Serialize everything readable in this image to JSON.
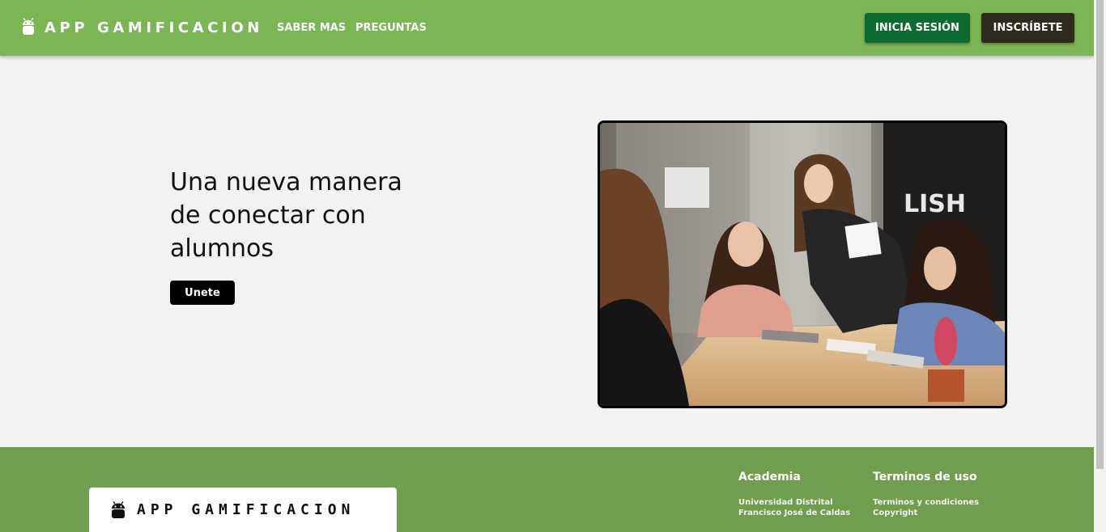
{
  "header": {
    "brand": "APP GAMIFICACION",
    "nav": [
      "SABER MAS",
      "PREGUNTAS"
    ],
    "login_label": "INICIA SESIÓN",
    "signup_label": "INSCRÍBETE"
  },
  "hero": {
    "title": "Una nueva manera de conectar con alumnos",
    "join_label": "Unete",
    "image_icon": "classroom-photo"
  },
  "footer": {
    "brand": "APP GAMIFICACION",
    "columns": [
      {
        "title": "Academia",
        "links": [
          "Universidad Distrital Francisco José de Caldas"
        ]
      },
      {
        "title": "Terminos de uso",
        "links": [
          "Terminos y condiciones",
          "Copyright"
        ]
      }
    ]
  },
  "colors": {
    "navbar": "#7cb554",
    "footer": "#6f9e4e",
    "login_button": "#0e6b2f",
    "signup_button": "#2f2a1f",
    "background": "#f2f2f2"
  }
}
